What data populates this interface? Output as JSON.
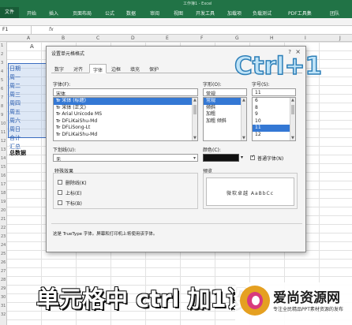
{
  "window": {
    "title_fragment": "工作簿1 - Excel"
  },
  "ribbon_tabs": [
    "文件",
    "开始",
    "插入",
    "页面布局",
    "公式",
    "数据",
    "审阅",
    "视图",
    "开发工具",
    "加载项",
    "负载测试",
    "PDF工具集",
    "团队"
  ],
  "formula_bar": {
    "name_box": "F1",
    "fx": "fx"
  },
  "sheet": {
    "column_headers": [
      "A",
      "B",
      "C",
      "D",
      "E",
      "F",
      "G",
      "H",
      "I",
      "J"
    ],
    "row_numbers": [
      "1",
      "2",
      "3",
      "4",
      "5",
      "6",
      "7",
      "8",
      "9",
      "10",
      "11",
      "12",
      "13",
      "14",
      "15",
      "16",
      "17",
      "18",
      "19",
      "20",
      "21",
      "22",
      "23",
      "24",
      "25",
      "26",
      "27",
      "28",
      "29",
      "30",
      "31",
      "32"
    ],
    "header_cell": "A",
    "cells": [
      "日期",
      "周一",
      "周二",
      "周三",
      "周四",
      "周五",
      "周六",
      "周日",
      "合计",
      "汇总"
    ],
    "total_label": "总数据"
  },
  "dialog": {
    "title": "设置单元格格式",
    "help": "?",
    "close": "×",
    "tabs": [
      "数字",
      "对齐",
      "字体",
      "边框",
      "填充",
      "保护"
    ],
    "active_tab": "字体",
    "font_label": "字体(F):",
    "font_value": "宋体",
    "font_list": [
      {
        "name": "宋体 (标题)",
        "selected": true
      },
      {
        "name": "宋体 (正文)",
        "selected": false
      },
      {
        "name": "Arial Unicode MS",
        "selected": false
      },
      {
        "name": "DFLiKaiShu-Md",
        "selected": false
      },
      {
        "name": "DFLiSong-Lt",
        "selected": false
      },
      {
        "name": "DFLiKaiShu-Md",
        "selected": false
      }
    ],
    "style_label": "字形(O):",
    "style_value": "常规",
    "style_list": [
      {
        "name": "常规",
        "selected": true
      },
      {
        "name": "倾斜",
        "selected": false
      },
      {
        "name": "加粗",
        "selected": false
      },
      {
        "name": "加粗 倾斜",
        "selected": false
      }
    ],
    "size_label": "字号(S):",
    "size_value": "11",
    "size_list": [
      {
        "name": "6",
        "selected": false
      },
      {
        "name": "8",
        "selected": false
      },
      {
        "name": "9",
        "selected": false
      },
      {
        "name": "10",
        "selected": false
      },
      {
        "name": "11",
        "selected": true
      },
      {
        "name": "12",
        "selected": false
      }
    ],
    "underline_label": "下划线(U):",
    "underline_value": "无",
    "color_label": "颜色(C):",
    "normal_font_label": "普通字体(N)",
    "effects_label": "特殊效果",
    "effects": [
      {
        "label": "删除线(K)",
        "checked": false
      },
      {
        "label": "上标(E)",
        "checked": false
      },
      {
        "label": "下标(B)",
        "checked": false
      }
    ],
    "preview_label": "预览",
    "preview_text": "微软卓越  AaBbCc",
    "info_text": "这是 TrueType 字体。屏幕和打印机上将使用该字体。"
  },
  "overlay": {
    "shortcut": "Ctrl+1",
    "caption": "单元格中 ctrl 加1设",
    "logo_name": "爱尚资源网",
    "logo_tagline": "专注全民精品PPT素材资源的发布"
  },
  "colors": {
    "excel_green": "#217346",
    "selection_blue": "#3478d4",
    "shortcut_fill": "#bfe3f7",
    "shortcut_stroke": "#2d7fb8",
    "cell_text_blue": "#2a5db0"
  }
}
